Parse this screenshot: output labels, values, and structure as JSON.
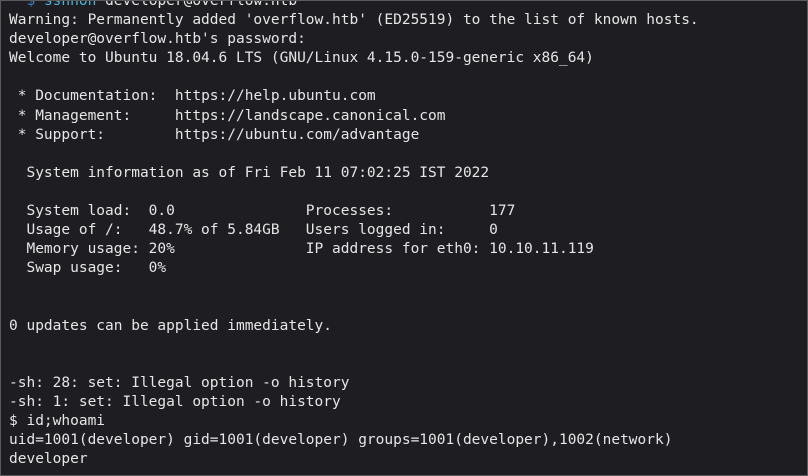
{
  "prompt": {
    "corner": "└─",
    "dollar": "$",
    "command": "sshnoh",
    "argument": "developer@overflow.htb"
  },
  "output": {
    "warning": "Warning: Permanently added 'overflow.htb' (ED25519) to the list of known hosts.",
    "password_prompt": "developer@overflow.htb's password:",
    "welcome": "Welcome to Ubuntu 18.04.6 LTS (GNU/Linux 4.15.0-159-generic x86_64)",
    "links": [
      {
        "label": " * Documentation:  ",
        "url": "https://help.ubuntu.com"
      },
      {
        "label": " * Management:     ",
        "url": "https://landscape.canonical.com"
      },
      {
        "label": " * Support:        ",
        "url": "https://ubuntu.com/advantage"
      }
    ],
    "sysinfo_heading": "  System information as of Fri Feb 11 07:02:25 IST 2022",
    "sysinfo_rows": [
      "  System load:  0.0               Processes:           177",
      "  Usage of /:   48.7% of 5.84GB   Users logged in:     0",
      "  Memory usage: 20%               IP address for eth0: 10.10.11.119",
      "  Swap usage:   0%"
    ],
    "updates": "0 updates can be applied immediately.",
    "errors": [
      "-sh: 28: set: Illegal option -o history",
      "-sh: 1: set: Illegal option -o history"
    ],
    "shell_command": "$ id;whoami",
    "id_result": "uid=1001(developer) gid=1001(developer) groups=1001(developer),1002(network)",
    "whoami_result": "developer"
  }
}
